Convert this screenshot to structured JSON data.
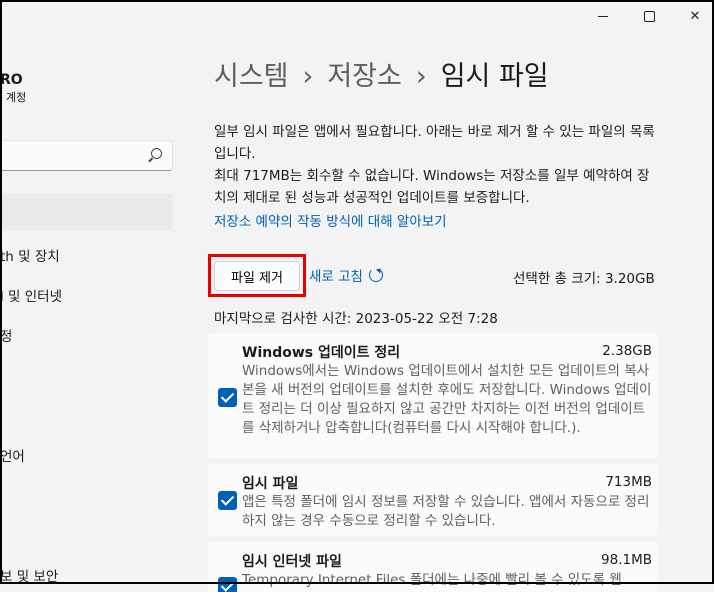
{
  "window": {
    "minimize": "—",
    "maximize": "☐",
    "close": "✕"
  },
  "sidebar": {
    "account_name": "RO",
    "account_sub": "계정",
    "nav": [
      {
        "label": "th 및 장치"
      },
      {
        "label": "l 및 인터넷"
      },
      {
        "label": "정"
      },
      {
        "label": "언어"
      },
      {
        "label": "보 및 보안"
      }
    ]
  },
  "breadcrumb": {
    "crumb1": "시스템",
    "crumb2": "저장소",
    "current": "임시 파일",
    "sep": "›"
  },
  "intro": {
    "p1": "일부 임시 파일은 앱에서 필요합니다. 아래는 바로 제거 할 수 있는 파일의 목록입니다.",
    "p2": "최대 717MB는 회수할 수 없습니다. Windows는 저장소를 일부 예약하여 장치의 제대로 된 성능과 성공적인 업데이트를 보증합니다.",
    "link": "저장소 예약의 작동 방식에 대해 알아보기"
  },
  "actions": {
    "remove_label": "파일 제거",
    "refresh_label": "새로 고침",
    "total_label": "선택한 총 크기: 3.20GB",
    "last_scan": "마지막으로 검사한 시간: 2023-05-22 오전 7:28"
  },
  "items": [
    {
      "title": "Windows 업데이트 정리",
      "size": "2.38GB",
      "desc": "Windows에서는 Windows 업데이트에서 설치한 모든 업데이트의 복사본을 새 버전의 업데이트를 설치한 후에도 저장합니다. Windows 업데이트 정리는 더 이상 필요하지 않고 공간만 차지하는 이전 버전의 업데이트를 삭제하거나 압축합니다(컴퓨터를 다시 시작해야 합니다.).",
      "checked": true
    },
    {
      "title": "임시 파일",
      "size": "713MB",
      "desc": "앱은 특정 폴더에 임시 정보를 저장할 수 있습니다. 앱에서 자동으로 정리하지 않는 경우 수동으로 정리할 수 있습니다.",
      "checked": true
    },
    {
      "title": "임시 인터넷 파일",
      "size": "98.1MB",
      "desc": "Temporary Internet Files 폴더에는 나중에 빨리 볼 수 있도록 웹",
      "checked": true
    }
  ],
  "colors": {
    "accent": "#005fb8",
    "highlight": "#e60000",
    "background": "#f3f3f3"
  }
}
